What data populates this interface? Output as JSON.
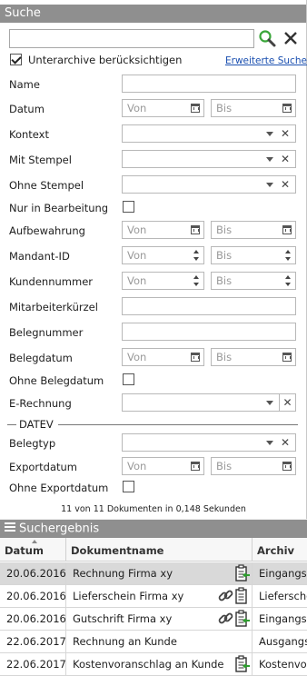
{
  "search_panel": {
    "title": "Suche",
    "search_value": "",
    "subarchive_label": "Unterarchive berücksichtigen",
    "subarchive_checked": true,
    "advanced_link": "Erweiterte Suche",
    "placeholder_from": "Von",
    "placeholder_to": "Bis",
    "fields": {
      "name": "Name",
      "datum": "Datum",
      "kontext": "Kontext",
      "mit_stempel": "Mit Stempel",
      "ohne_stempel": "Ohne Stempel",
      "nur_in_bearbeitung": "Nur in Bearbeitung",
      "aufbewahrung": "Aufbewahrung",
      "mandant_id": "Mandant-ID",
      "kundennummer": "Kundennummer",
      "mitarbeiterkuerzel": "Mitarbeiterkürzel",
      "belegnummer": "Belegnummer",
      "belegdatum": "Belegdatum",
      "ohne_belegdatum": "Ohne Belegdatum",
      "e_rechnung": "E-Rechnung"
    },
    "datev_section": {
      "title": "DATEV",
      "belegtyp": "Belegtyp",
      "exportdatum": "Exportdatum",
      "ohne_exportdatum": "Ohne Exportdatum"
    },
    "status": "11 von 11 Dokumenten in 0,148 Sekunden"
  },
  "result_panel": {
    "title": "Suchergebnis",
    "columns": [
      "Datum",
      "Dokumentname",
      "Archiv"
    ],
    "rows": [
      {
        "date": "20.06.2016",
        "name": "Rechnung Firma xy",
        "archive": "Eingangsrechnungen",
        "selected": true,
        "link": false,
        "icon": "document-export-icon"
      },
      {
        "date": "20.06.2016",
        "name": "Lieferschein Firma xy",
        "archive": "Lieferscheine",
        "selected": false,
        "link": true,
        "icon": "document-icon"
      },
      {
        "date": "20.06.2016",
        "name": "Gutschrift Firma xy",
        "archive": "Eingangsrechnungen",
        "selected": false,
        "link": true,
        "icon": "document-export-icon"
      },
      {
        "date": "22.06.2017",
        "name": "Rechnung an Kunde",
        "archive": "Ausgangsrechnungen",
        "selected": false,
        "link": false,
        "icon": ""
      },
      {
        "date": "22.06.2017",
        "name": "Kostenvoranschlag an Kunde",
        "archive": "Kostenvoranschläge",
        "selected": false,
        "link": false,
        "icon": "document-export-icon"
      }
    ]
  },
  "colors": {
    "header_bg": "#8f8f8f",
    "selected_row": "#d9d9d9",
    "link": "#1a4fb0",
    "search_icon_green": "#3aa63a",
    "export_arrow_green": "#2e9e2e"
  }
}
